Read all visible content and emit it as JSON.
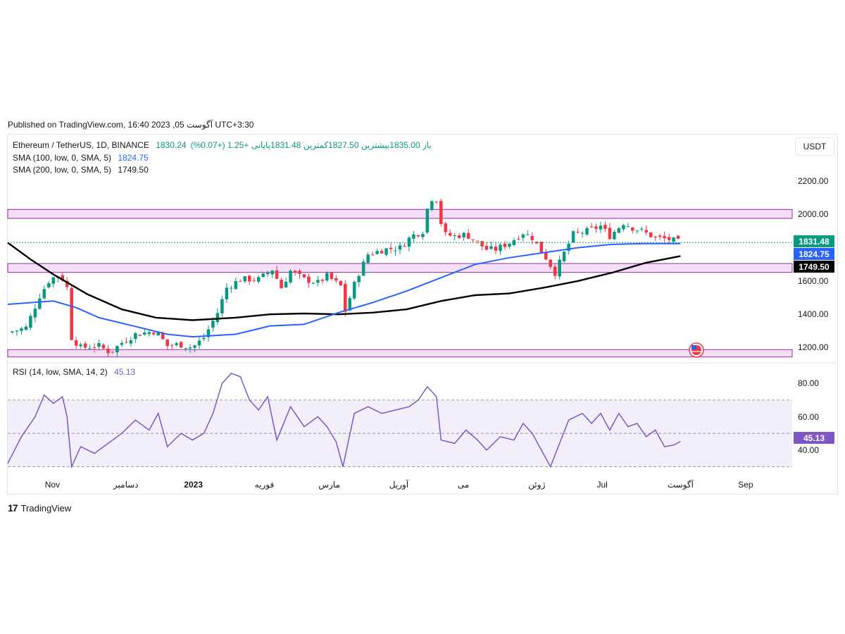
{
  "header": {
    "published": "Published on TradingView.com, 16:40 2023 ,05 آگوست UTC+3:30"
  },
  "legend": {
    "symbol": "Ethereum / TetherUS, 1D, BINANCE",
    "ohlc": "1830.24باز 1835.00بیشترین 1827.50کمترین 1831.48پایانی",
    "change": "+1.25 (+0.07%)",
    "sma100_label": "SMA (100, low, 0, SMA, 5)",
    "sma100_value": "1824.75",
    "sma200_label": "SMA (200, low, 0, SMA, 5)",
    "sma200_value": "1749.50",
    "rsi_label": "RSI (14, low, SMA, 14, 2)",
    "rsi_value": "45.13"
  },
  "currency_button": "USDT",
  "price_tags": {
    "last": "1831.48",
    "sma100": "1824.75",
    "sma200": "1749.50",
    "rsi": "45.13"
  },
  "colors": {
    "up": "#089981",
    "down": "#f23645",
    "sma100": "#2962ff",
    "sma200": "#000000",
    "rsi": "#7e57c2",
    "zone_fill": "#f3e0f7",
    "zone_border": "#9c27b0"
  },
  "brand": "TradingView",
  "chart_data": [
    {
      "type": "candlestick",
      "title": "Ethereum / TetherUS, 1D, BINANCE",
      "y_ticks": [
        "2200.00",
        "2000.00",
        "1600.00",
        "1400.00",
        "1200.00"
      ],
      "ylim": [
        1130,
        2230
      ],
      "x_ticks": [
        "Nov",
        "دسامبر",
        "2023",
        "فوریه",
        "مارس",
        "آوریل",
        "می",
        "ژوئن",
        "Jul",
        "آگوست",
        "Sep"
      ],
      "x_tick_days": [
        0,
        30,
        61,
        92,
        120,
        151,
        181,
        212,
        242,
        273,
        304
      ],
      "x_range_days": [
        -20,
        324
      ],
      "close_series": [
        {
          "day": -20,
          "value": 1290
        },
        {
          "day": -12,
          "value": 1320
        },
        {
          "day": -6,
          "value": 1510
        },
        {
          "day": -2,
          "value": 1600
        },
        {
          "day": 0,
          "value": 1620
        },
        {
          "day": 3,
          "value": 1640
        },
        {
          "day": 6,
          "value": 1560
        },
        {
          "day": 8,
          "value": 1260
        },
        {
          "day": 12,
          "value": 1200
        },
        {
          "day": 20,
          "value": 1210
        },
        {
          "day": 25,
          "value": 1170
        },
        {
          "day": 30,
          "value": 1230
        },
        {
          "day": 36,
          "value": 1280
        },
        {
          "day": 45,
          "value": 1300
        },
        {
          "day": 50,
          "value": 1210
        },
        {
          "day": 55,
          "value": 1220
        },
        {
          "day": 61,
          "value": 1200
        },
        {
          "day": 66,
          "value": 1260
        },
        {
          "day": 72,
          "value": 1410
        },
        {
          "day": 76,
          "value": 1560
        },
        {
          "day": 82,
          "value": 1610
        },
        {
          "day": 90,
          "value": 1610
        },
        {
          "day": 96,
          "value": 1670
        },
        {
          "day": 100,
          "value": 1560
        },
        {
          "day": 104,
          "value": 1660
        },
        {
          "day": 110,
          "value": 1610
        },
        {
          "day": 116,
          "value": 1590
        },
        {
          "day": 120,
          "value": 1630
        },
        {
          "day": 126,
          "value": 1570
        },
        {
          "day": 128,
          "value": 1420
        },
        {
          "day": 133,
          "value": 1620
        },
        {
          "day": 138,
          "value": 1760
        },
        {
          "day": 145,
          "value": 1790
        },
        {
          "day": 152,
          "value": 1800
        },
        {
          "day": 157,
          "value": 1870
        },
        {
          "day": 162,
          "value": 1900
        },
        {
          "day": 165,
          "value": 2100
        },
        {
          "day": 168,
          "value": 2090
        },
        {
          "day": 171,
          "value": 1880
        },
        {
          "day": 176,
          "value": 1870
        },
        {
          "day": 181,
          "value": 1880
        },
        {
          "day": 186,
          "value": 1830
        },
        {
          "day": 190,
          "value": 1790
        },
        {
          "day": 194,
          "value": 1790
        },
        {
          "day": 200,
          "value": 1830
        },
        {
          "day": 206,
          "value": 1890
        },
        {
          "day": 210,
          "value": 1860
        },
        {
          "day": 216,
          "value": 1740
        },
        {
          "day": 220,
          "value": 1650
        },
        {
          "day": 223,
          "value": 1740
        },
        {
          "day": 228,
          "value": 1880
        },
        {
          "day": 234,
          "value": 1900
        },
        {
          "day": 240,
          "value": 1930
        },
        {
          "day": 244,
          "value": 1870
        },
        {
          "day": 250,
          "value": 1950
        },
        {
          "day": 254,
          "value": 1920
        },
        {
          "day": 258,
          "value": 1900
        },
        {
          "day": 264,
          "value": 1860
        },
        {
          "day": 270,
          "value": 1850
        },
        {
          "day": 275,
          "value": 1831
        }
      ],
      "support_zones": [
        [
          1976,
          2030
        ],
        [
          1652,
          1705
        ],
        [
          1144,
          1188
        ]
      ],
      "last_price": 1831.48,
      "sma100": [
        {
          "day": -20,
          "value": 1460
        },
        {
          "day": 0,
          "value": 1480
        },
        {
          "day": 10,
          "value": 1440
        },
        {
          "day": 20,
          "value": 1380
        },
        {
          "day": 35,
          "value": 1330
        },
        {
          "day": 50,
          "value": 1280
        },
        {
          "day": 61,
          "value": 1265
        },
        {
          "day": 80,
          "value": 1280
        },
        {
          "day": 95,
          "value": 1330
        },
        {
          "day": 110,
          "value": 1340
        },
        {
          "day": 125,
          "value": 1410
        },
        {
          "day": 140,
          "value": 1470
        },
        {
          "day": 155,
          "value": 1540
        },
        {
          "day": 170,
          "value": 1620
        },
        {
          "day": 185,
          "value": 1700
        },
        {
          "day": 200,
          "value": 1740
        },
        {
          "day": 215,
          "value": 1770
        },
        {
          "day": 230,
          "value": 1800
        },
        {
          "day": 245,
          "value": 1820
        },
        {
          "day": 260,
          "value": 1825
        },
        {
          "day": 275,
          "value": 1824.75
        }
      ],
      "sma200": [
        {
          "day": -20,
          "value": 1830
        },
        {
          "day": -10,
          "value": 1730
        },
        {
          "day": 0,
          "value": 1640
        },
        {
          "day": 15,
          "value": 1520
        },
        {
          "day": 30,
          "value": 1430
        },
        {
          "day": 45,
          "value": 1380
        },
        {
          "day": 61,
          "value": 1365
        },
        {
          "day": 80,
          "value": 1380
        },
        {
          "day": 95,
          "value": 1400
        },
        {
          "day": 110,
          "value": 1405
        },
        {
          "day": 125,
          "value": 1400
        },
        {
          "day": 140,
          "value": 1410
        },
        {
          "day": 155,
          "value": 1430
        },
        {
          "day": 170,
          "value": 1480
        },
        {
          "day": 185,
          "value": 1515
        },
        {
          "day": 200,
          "value": 1525
        },
        {
          "day": 215,
          "value": 1560
        },
        {
          "day": 230,
          "value": 1600
        },
        {
          "day": 245,
          "value": 1650
        },
        {
          "day": 260,
          "value": 1710
        },
        {
          "day": 275,
          "value": 1749.5
        }
      ]
    },
    {
      "type": "line",
      "title": "RSI (14, low, SMA, 14, 2)",
      "y_ticks": [
        "80.00",
        "60.00",
        "40.00"
      ],
      "levels": [
        70,
        50,
        30
      ],
      "ylim": [
        26,
        86
      ],
      "series": [
        {
          "day": -20,
          "value": 32
        },
        {
          "day": -14,
          "value": 48
        },
        {
          "day": -8,
          "value": 60
        },
        {
          "day": -4,
          "value": 73
        },
        {
          "day": 0,
          "value": 68
        },
        {
          "day": 4,
          "value": 72
        },
        {
          "day": 6,
          "value": 60
        },
        {
          "day": 8,
          "value": 30
        },
        {
          "day": 12,
          "value": 42
        },
        {
          "day": 18,
          "value": 38
        },
        {
          "day": 24,
          "value": 44
        },
        {
          "day": 30,
          "value": 50
        },
        {
          "day": 36,
          "value": 58
        },
        {
          "day": 42,
          "value": 52
        },
        {
          "day": 46,
          "value": 62
        },
        {
          "day": 50,
          "value": 42
        },
        {
          "day": 56,
          "value": 50
        },
        {
          "day": 61,
          "value": 46
        },
        {
          "day": 66,
          "value": 50
        },
        {
          "day": 70,
          "value": 62
        },
        {
          "day": 74,
          "value": 80
        },
        {
          "day": 78,
          "value": 86
        },
        {
          "day": 82,
          "value": 84
        },
        {
          "day": 86,
          "value": 70
        },
        {
          "day": 90,
          "value": 64
        },
        {
          "day": 94,
          "value": 72
        },
        {
          "day": 98,
          "value": 46
        },
        {
          "day": 104,
          "value": 66
        },
        {
          "day": 110,
          "value": 54
        },
        {
          "day": 116,
          "value": 60
        },
        {
          "day": 120,
          "value": 54
        },
        {
          "day": 124,
          "value": 45
        },
        {
          "day": 127,
          "value": 30
        },
        {
          "day": 132,
          "value": 62
        },
        {
          "day": 138,
          "value": 66
        },
        {
          "day": 144,
          "value": 62
        },
        {
          "day": 150,
          "value": 64
        },
        {
          "day": 156,
          "value": 66
        },
        {
          "day": 160,
          "value": 70
        },
        {
          "day": 164,
          "value": 78
        },
        {
          "day": 168,
          "value": 72
        },
        {
          "day": 170,
          "value": 46
        },
        {
          "day": 176,
          "value": 44
        },
        {
          "day": 181,
          "value": 52
        },
        {
          "day": 186,
          "value": 46
        },
        {
          "day": 190,
          "value": 40
        },
        {
          "day": 196,
          "value": 48
        },
        {
          "day": 202,
          "value": 46
        },
        {
          "day": 206,
          "value": 56
        },
        {
          "day": 210,
          "value": 50
        },
        {
          "day": 214,
          "value": 40
        },
        {
          "day": 218,
          "value": 30
        },
        {
          "day": 222,
          "value": 44
        },
        {
          "day": 226,
          "value": 58
        },
        {
          "day": 232,
          "value": 62
        },
        {
          "day": 236,
          "value": 56
        },
        {
          "day": 240,
          "value": 62
        },
        {
          "day": 244,
          "value": 52
        },
        {
          "day": 248,
          "value": 62
        },
        {
          "day": 252,
          "value": 54
        },
        {
          "day": 256,
          "value": 56
        },
        {
          "day": 260,
          "value": 48
        },
        {
          "day": 264,
          "value": 52
        },
        {
          "day": 268,
          "value": 42
        },
        {
          "day": 272,
          "value": 43
        },
        {
          "day": 275,
          "value": 45.13
        }
      ]
    }
  ]
}
